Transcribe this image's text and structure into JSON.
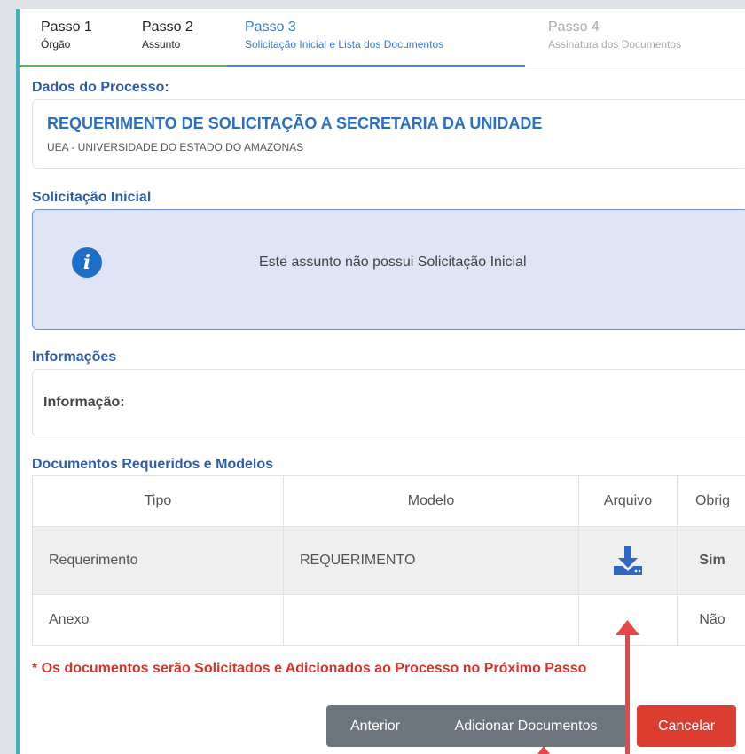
{
  "steps": [
    {
      "title": "Passo 1",
      "subtitle": "Órgão"
    },
    {
      "title": "Passo 2",
      "subtitle": "Assunto"
    },
    {
      "title": "Passo 3",
      "subtitle": "Solicitação Inicial e Lista dos Documentos"
    },
    {
      "title": "Passo 4",
      "subtitle": "Assinatura dos Documentos"
    }
  ],
  "process": {
    "section_title": "Dados do Processo:",
    "title": "REQUERIMENTO DE SOLICITAÇÃO A SECRETARIA DA UNIDADE",
    "subtitle": "UEA - UNIVERSIDADE DO ESTADO DO AMAZONAS"
  },
  "initial_request": {
    "section_title": "Solicitação Inicial",
    "message": "Este assunto não possui Solicitação Inicial",
    "icon": "info-icon"
  },
  "info": {
    "section_title": "Informações",
    "label": "Informação:"
  },
  "documents": {
    "section_title": "Documentos Requeridos e Modelos",
    "columns": [
      "Tipo",
      "Modelo",
      "Arquivo",
      "Obrig"
    ],
    "rows": [
      {
        "tipo": "Requerimento",
        "modelo": "REQUERIMENTO",
        "arquivo_icon": "download-icon",
        "obrig": "Sim"
      },
      {
        "tipo": "Anexo",
        "modelo": "",
        "arquivo_icon": "",
        "obrig": "Não"
      }
    ]
  },
  "note": "* Os documentos serão Solicitados e Adicionados ao Processo no Próximo Passo",
  "buttons": {
    "previous": "Anterior",
    "add_documents": "Adicionar Documentos",
    "cancel": "Cancelar"
  },
  "colors": {
    "accent": "#2f5ca8",
    "step_active": "#4f86d9",
    "step_done": "#5cb85c",
    "danger": "#dc3d31",
    "annotation_arrow": "#e8474a"
  }
}
